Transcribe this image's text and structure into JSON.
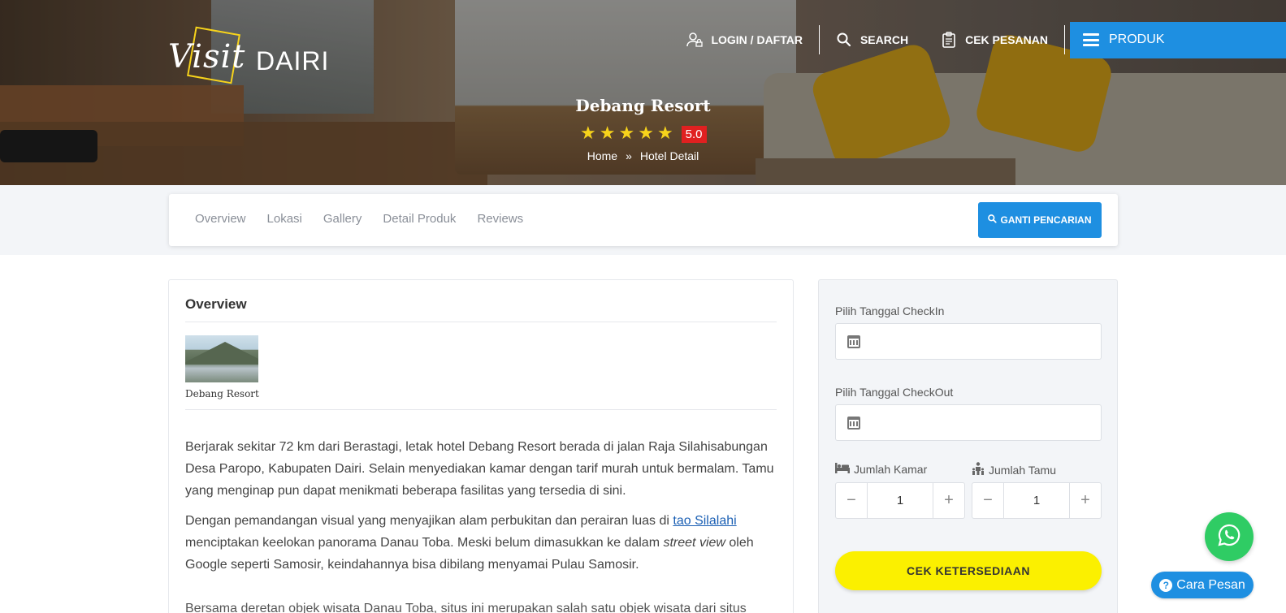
{
  "brand": {
    "logo_script": "Visit",
    "logo_name": "DAIRI",
    "accent": "#1e8fe1",
    "star_color": "#f7d31b",
    "cta_color": "#fbf000"
  },
  "nav": {
    "login": "LOGIN / DAFTAR",
    "search": "SEARCH",
    "cek_pesanan": "CEK PESANAN",
    "produk": "PRODUK"
  },
  "hero": {
    "title": "Debang Resort",
    "rating": 5,
    "score": "5.0",
    "breadcrumb": [
      "Home",
      "Hotel Detail"
    ]
  },
  "tabs": [
    "Overview",
    "Lokasi",
    "Gallery",
    "Detail Produk",
    "Reviews"
  ],
  "ganti_pencarian": "GANTI PENCARIAN",
  "overview": {
    "title": "Overview",
    "thumb_caption": "Debang Resort",
    "p1": "Berjarak sekitar 72 km dari Berastagi, letak hotel Debang Resort berada di jalan Raja Silahisabungan Desa Paropo, Kabupaten Dairi. Selain menyediakan kamar dengan tarif murah untuk bermalam. Tamu yang menginap pun dapat menikmati beberapa fasilitas yang tersedia di sini.",
    "p2_pre": "Dengan pemandangan visual yang menyajikan alam perbukitan dan perairan luas di ",
    "p2_link": "tao Silalahi",
    "p2_mid": " menciptakan keelokan panorama Danau Toba. Meski belum dimasukkan ke dalam ",
    "p2_em1": "street view",
    "p2_post": " oleh Google seperti Samosir, keindahannya bisa dibilang menyamai Pulau Samosir.",
    "p3": "Bersama deretan objek wisata Danau Toba, situs ini merupakan salah satu objek wisata dari situs pariwisata Kabupaten Dairi."
  },
  "booking": {
    "checkin_label": "Pilih Tanggal CheckIn",
    "checkin_value": "",
    "checkout_label": "Pilih Tanggal CheckOut",
    "checkout_value": "",
    "kamar_label": "Jumlah Kamar",
    "kamar_value": "1",
    "tamu_label": "Jumlah Tamu",
    "tamu_value": "1",
    "minus": "−",
    "plus": "+",
    "cek": "CEK KETERSEDIAAN"
  },
  "help": {
    "cara_pesan": "Cara Pesan",
    "whatsapp_icon": "whatsapp-icon"
  }
}
